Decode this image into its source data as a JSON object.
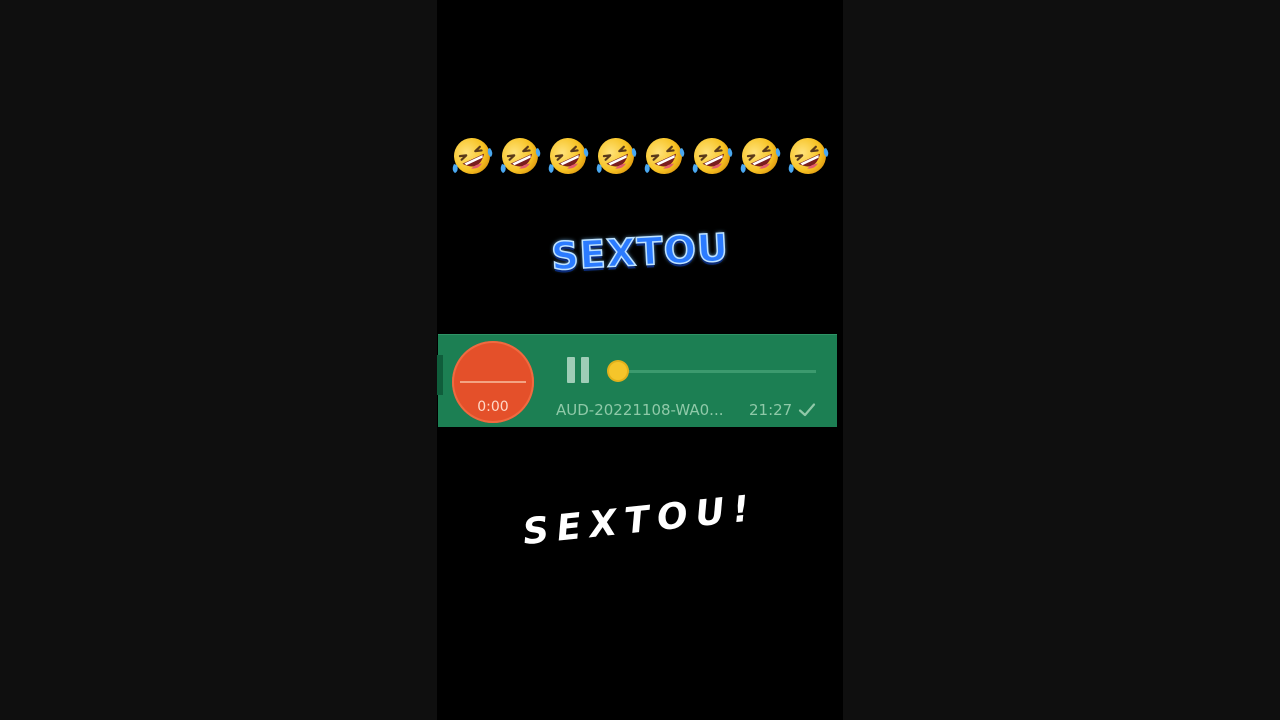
{
  "emoji_row": {
    "icon": "rolling-on-floor-laughing-emoji",
    "count": 8
  },
  "top_caption": "SEXTOU",
  "voice_message": {
    "record_time": "0:00",
    "file_name": "AUD-20221108-WA0...",
    "time": "21:27",
    "status_icon": "check-icon",
    "progress": 0,
    "colors": {
      "bubble": "#1c7f53",
      "record_button": "#e4502a",
      "thumb": "#f5c52a"
    }
  },
  "bottom_caption": "SEXTOU!"
}
